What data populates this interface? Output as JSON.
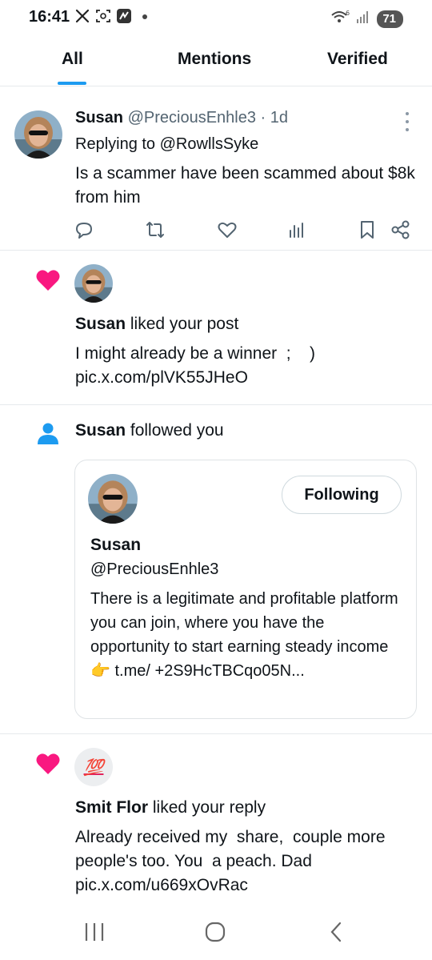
{
  "status_bar": {
    "time": "16:41",
    "battery": "71"
  },
  "tabs": [
    {
      "label": "All",
      "active": true
    },
    {
      "label": "Mentions",
      "active": false
    },
    {
      "label": "Verified",
      "active": false
    }
  ],
  "reply_post": {
    "name": "Susan",
    "handle": "@PreciousEnhle3",
    "time": "· 1d",
    "replying_to_prefix": "Replying to",
    "replying_to_handle": "@RowllsSyke",
    "text": "Is a scammer have been scammed about $8k from him"
  },
  "like_notification_1": {
    "name": "Susan",
    "action": "liked your post",
    "text_line1": "I might already be a winner  ;    )",
    "text_line2": "pic.x.com/plVK55JHeO"
  },
  "follow_notification": {
    "name": "Susan",
    "action": "followed you",
    "card": {
      "button_label": "Following",
      "name": "Susan",
      "handle": "@PreciousEnhle3",
      "bio": "There is a legitimate and profitable platform you can join, where you have the opportunity to start earning steady income👉 t.me/ +2S9HcTBCqo05N..."
    }
  },
  "like_notification_2": {
    "avatar_glyph": "💯",
    "name": "Smit Flor",
    "action": "liked your reply",
    "text": "Already received my  share,  couple more people's too. You  a peach. Dad pic.x.com/u669xOvRac"
  },
  "colors": {
    "accent": "#1d9bf0",
    "like": "#f91880",
    "text": "#0f1419",
    "muted": "#536471"
  }
}
